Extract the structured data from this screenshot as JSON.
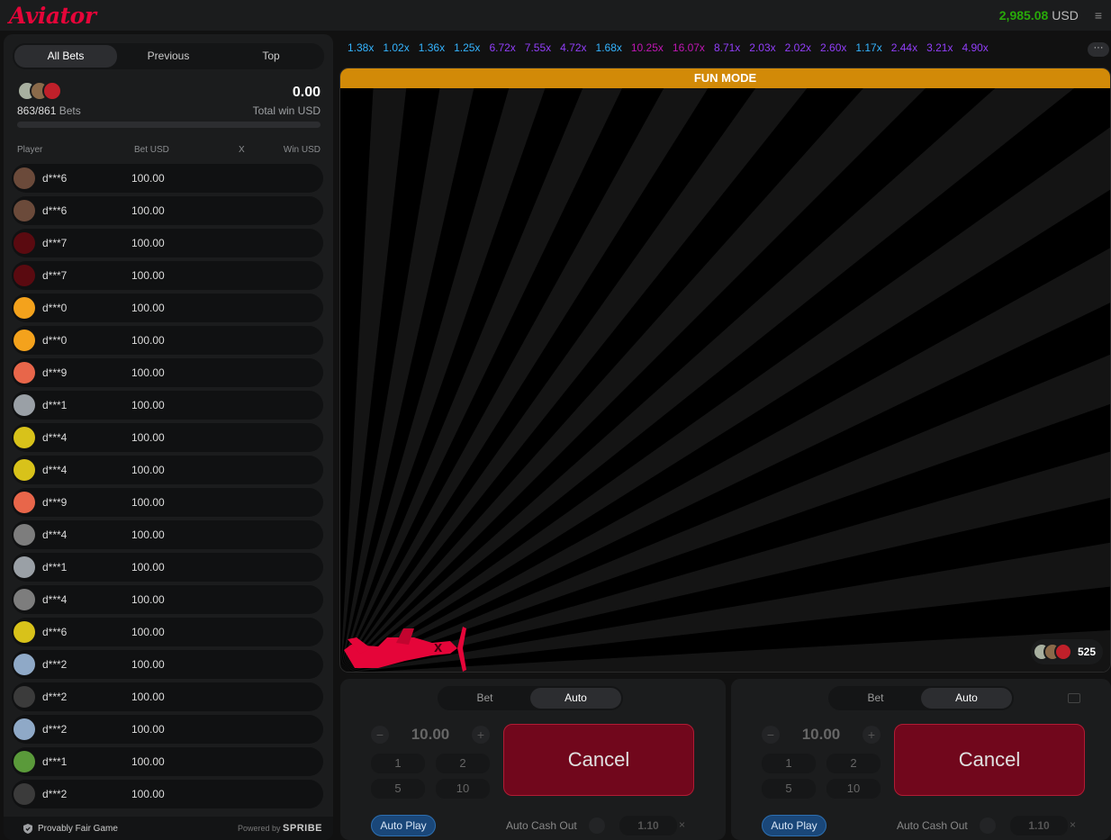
{
  "header": {
    "logo": "Aviator",
    "balance": "2,985.08",
    "currency": "USD",
    "menu_icon": "≡"
  },
  "left_panel": {
    "tabs": [
      {
        "label": "All Bets",
        "active": true
      },
      {
        "label": "Previous",
        "active": false
      },
      {
        "label": "Top",
        "active": false
      }
    ],
    "bets_count": "863/861",
    "bets_label": "Bets",
    "total_win": "0.00",
    "total_win_label": "Total win USD",
    "columns": {
      "player": "Player",
      "bet": "Bet USD",
      "x": "X",
      "win": "Win USD"
    },
    "rows": [
      {
        "name": "d***6",
        "bet": "100.00",
        "avatar_color": "#6b4a3a"
      },
      {
        "name": "d***6",
        "bet": "100.00",
        "avatar_color": "#6b4a3a"
      },
      {
        "name": "d***7",
        "bet": "100.00",
        "avatar_color": "#5a0a10"
      },
      {
        "name": "d***7",
        "bet": "100.00",
        "avatar_color": "#5a0a10"
      },
      {
        "name": "d***0",
        "bet": "100.00",
        "avatar_color": "#f4a21c"
      },
      {
        "name": "d***0",
        "bet": "100.00",
        "avatar_color": "#f4a21c"
      },
      {
        "name": "d***9",
        "bet": "100.00",
        "avatar_color": "#e8664a"
      },
      {
        "name": "d***1",
        "bet": "100.00",
        "avatar_color": "#9aa0a6"
      },
      {
        "name": "d***4",
        "bet": "100.00",
        "avatar_color": "#d8c21a"
      },
      {
        "name": "d***4",
        "bet": "100.00",
        "avatar_color": "#d8c21a"
      },
      {
        "name": "d***9",
        "bet": "100.00",
        "avatar_color": "#e8664a"
      },
      {
        "name": "d***4",
        "bet": "100.00",
        "avatar_color": "#7d7d7d"
      },
      {
        "name": "d***1",
        "bet": "100.00",
        "avatar_color": "#9aa0a6"
      },
      {
        "name": "d***4",
        "bet": "100.00",
        "avatar_color": "#7d7d7d"
      },
      {
        "name": "d***6",
        "bet": "100.00",
        "avatar_color": "#d8c21a"
      },
      {
        "name": "d***2",
        "bet": "100.00",
        "avatar_color": "#8fa9c7"
      },
      {
        "name": "d***2",
        "bet": "100.00",
        "avatar_color": "#3b3b3b"
      },
      {
        "name": "d***2",
        "bet": "100.00",
        "avatar_color": "#8fa9c7"
      },
      {
        "name": "d***1",
        "bet": "100.00",
        "avatar_color": "#5a9a3a"
      },
      {
        "name": "d***2",
        "bet": "100.00",
        "avatar_color": "#3b3b3b"
      }
    ],
    "footer": {
      "provably_fair": "Provably Fair Game",
      "powered_by": "Powered by",
      "brand": "SPRIBE"
    }
  },
  "history": [
    {
      "value": "1.38x",
      "color": "#34b4ff"
    },
    {
      "value": "1.02x",
      "color": "#34b4ff"
    },
    {
      "value": "1.36x",
      "color": "#34b4ff"
    },
    {
      "value": "1.25x",
      "color": "#34b4ff"
    },
    {
      "value": "6.72x",
      "color": "#913ef8"
    },
    {
      "value": "7.55x",
      "color": "#913ef8"
    },
    {
      "value": "4.72x",
      "color": "#913ef8"
    },
    {
      "value": "1.68x",
      "color": "#34b4ff"
    },
    {
      "value": "10.25x",
      "color": "#c017b4"
    },
    {
      "value": "16.07x",
      "color": "#c017b4"
    },
    {
      "value": "8.71x",
      "color": "#913ef8"
    },
    {
      "value": "2.03x",
      "color": "#913ef8"
    },
    {
      "value": "2.02x",
      "color": "#913ef8"
    },
    {
      "value": "2.60x",
      "color": "#913ef8"
    },
    {
      "value": "1.17x",
      "color": "#34b4ff"
    },
    {
      "value": "2.44x",
      "color": "#913ef8"
    },
    {
      "value": "3.21x",
      "color": "#913ef8"
    },
    {
      "value": "4.90x",
      "color": "#913ef8"
    }
  ],
  "history_more": "···",
  "game": {
    "fun_mode": "FUN MODE",
    "online_count": "525"
  },
  "bet_panels": [
    {
      "tabs": [
        "Bet",
        "Auto"
      ],
      "active_tab": "Auto",
      "amount": "10.00",
      "minus": "−",
      "plus": "+",
      "quick": [
        "1",
        "2",
        "5",
        "10"
      ],
      "cancel_label": "Cancel",
      "auto_play": "Auto Play",
      "auto_cash_out": "Auto Cash Out",
      "cash_out_value": "1.10",
      "clear": "×"
    },
    {
      "tabs": [
        "Bet",
        "Auto"
      ],
      "active_tab": "Auto",
      "amount": "10.00",
      "minus": "−",
      "plus": "+",
      "quick": [
        "1",
        "2",
        "5",
        "10"
      ],
      "cancel_label": "Cancel",
      "auto_play": "Auto Play",
      "auto_cash_out": "Auto Cash Out",
      "cash_out_value": "1.10",
      "clear": "×"
    }
  ]
}
